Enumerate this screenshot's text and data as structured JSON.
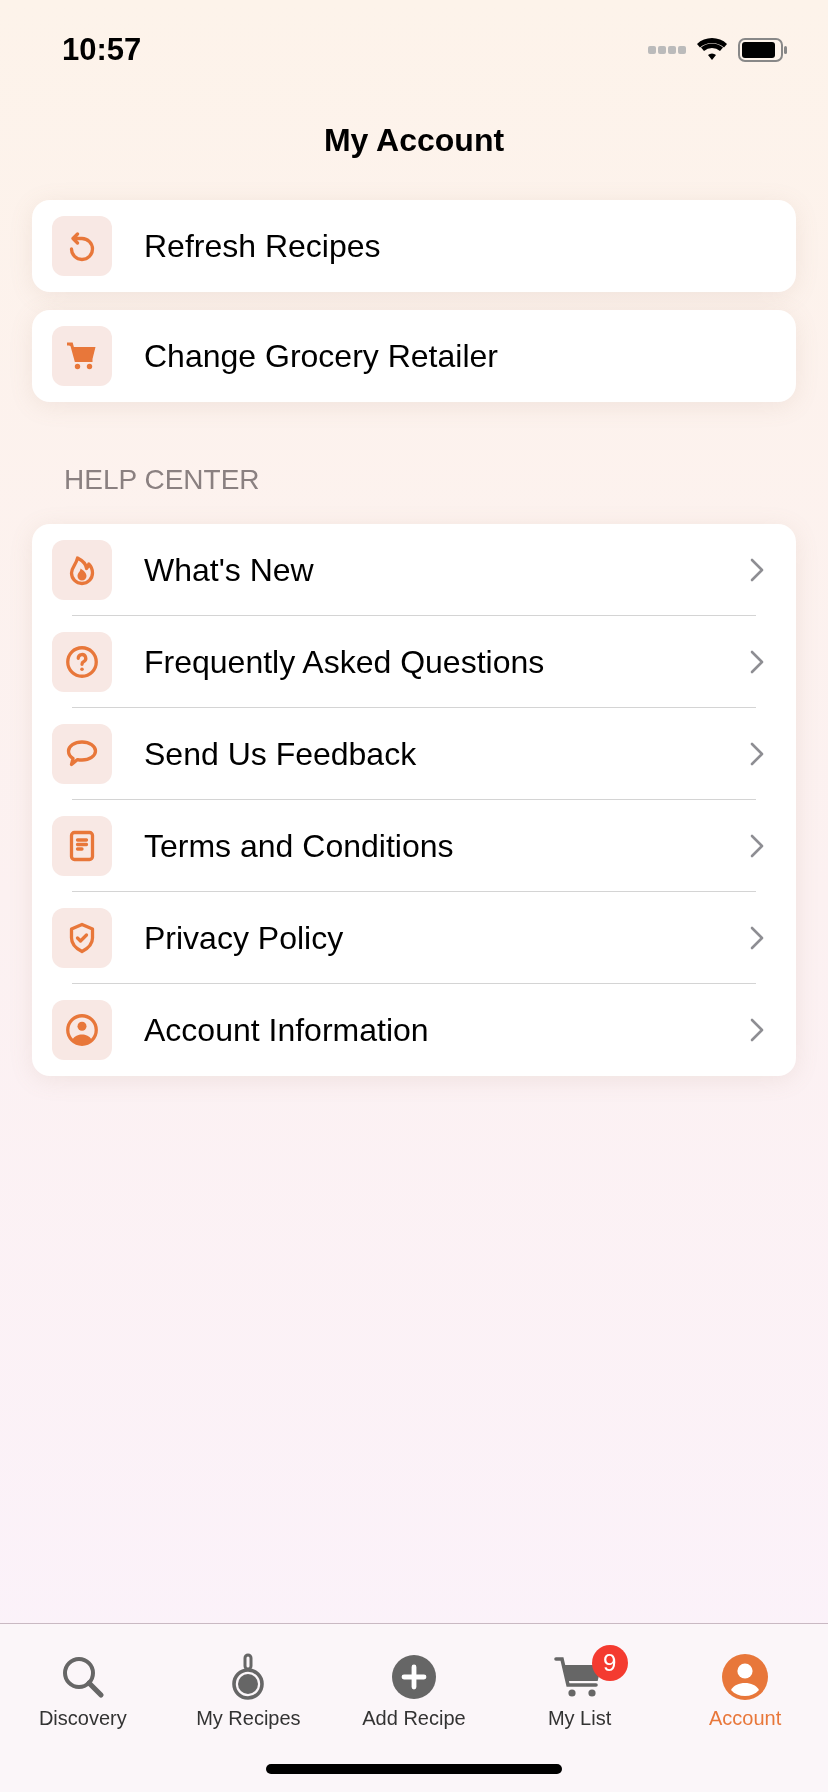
{
  "status_bar": {
    "time": "10:57"
  },
  "title": "My Account",
  "actions": [
    {
      "kind": "refresh",
      "label": "Refresh Recipes"
    },
    {
      "kind": "cart",
      "label": "Change Grocery Retailer"
    }
  ],
  "help_center": {
    "heading": "HELP CENTER",
    "items": [
      {
        "kind": "flame",
        "label": "What's New"
      },
      {
        "kind": "question",
        "label": "Frequently Asked Questions"
      },
      {
        "kind": "speech",
        "label": "Send Us Feedback"
      },
      {
        "kind": "document",
        "label": "Terms and Conditions"
      },
      {
        "kind": "shield",
        "label": "Privacy Policy"
      },
      {
        "kind": "person",
        "label": "Account Information"
      }
    ]
  },
  "tab_bar": [
    {
      "kind": "search",
      "label": "Discovery",
      "selected": false
    },
    {
      "kind": "pan",
      "label": "My Recipes",
      "selected": false
    },
    {
      "kind": "plus",
      "label": "Add Recipe",
      "selected": false
    },
    {
      "kind": "cart",
      "label": "My List",
      "selected": false,
      "badge": "9"
    },
    {
      "kind": "person",
      "label": "Account",
      "selected": true
    }
  ]
}
